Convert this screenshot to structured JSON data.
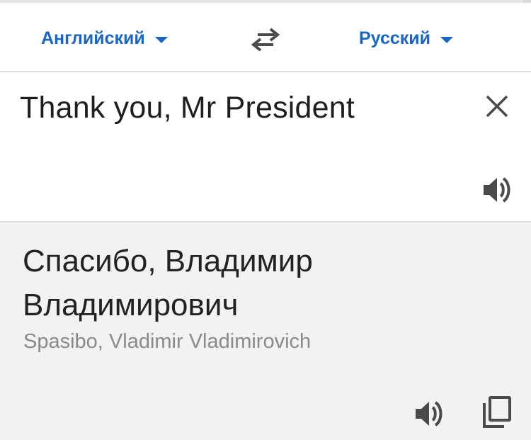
{
  "languages": {
    "source_label": "Английский",
    "target_label": "Русский"
  },
  "source": {
    "text": "Thank you, Mr President"
  },
  "result": {
    "line1": "Спасибо, Владимир",
    "line2": "Владимирович",
    "transliteration": "Spasibo, Vladimir Vladimirovich"
  },
  "icons": {
    "swap": "swap-arrows-icon",
    "clear": "close-icon",
    "speak": "speaker-icon",
    "copy": "copy-icon",
    "dropdown": "caret-down-icon"
  },
  "colors": {
    "accent": "#1a66c7",
    "source_text": "#1e1e1e",
    "result_bg": "#f2f2f2",
    "transliteration": "#8a8a8a",
    "icon": "#4a4a4a"
  }
}
